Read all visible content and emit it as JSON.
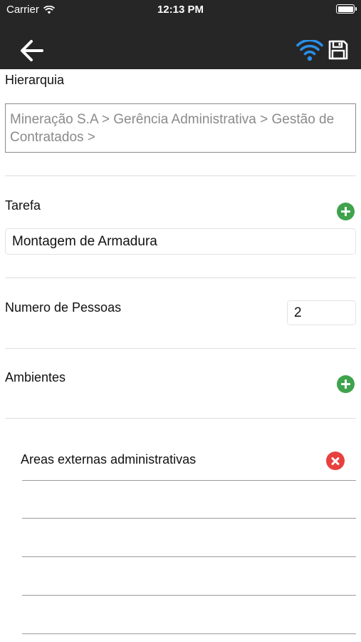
{
  "status_bar": {
    "carrier": "Carrier",
    "time": "12:13 PM"
  },
  "nav": {
    "back_icon": "arrow-left-icon",
    "wifi_icon": "wifi-icon",
    "save_icon": "floppy-disk-icon",
    "wifi_color": "#2b8fe8"
  },
  "form": {
    "hierarquia_label": "Hierarquia",
    "hierarquia_path": "Mineração S.A >  Gerência Administrativa >  Gestão de Contratados >",
    "tarefa_label": "Tarefa",
    "tarefa_value": "Montagem de Armadura",
    "numero_pessoas_label": "Numero de Pessoas",
    "numero_pessoas_value": "2",
    "ambientes_label": "Ambientes"
  },
  "ambientes": {
    "items": [
      {
        "label": "Areas externas administrativas"
      }
    ]
  },
  "colors": {
    "topbar": "#262626",
    "add_green": "#3fa34d",
    "remove_red": "#e8403f"
  }
}
